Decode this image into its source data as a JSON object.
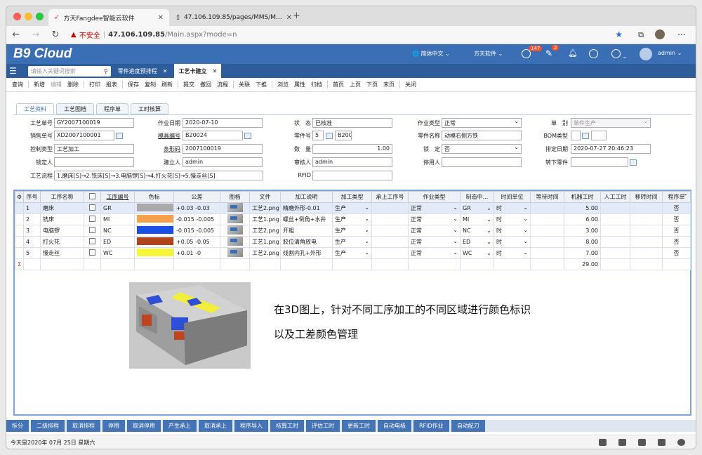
{
  "browser": {
    "tabs": [
      {
        "title": "方天Fangdee智能云软件"
      },
      {
        "title": "47.106.109.85/pages/MMS/M..."
      }
    ],
    "not_secure": "不安全",
    "url_host": "47.106.109.85",
    "url_path": "/Main.aspx?mode=n"
  },
  "app": {
    "logo": "B9 Cloud",
    "language": "简体中文",
    "company": "方天软件",
    "msg_count": "147",
    "edit_count": "2",
    "user": "admin"
  },
  "nav": {
    "search_placeholder": "请输入关键词搜索",
    "tabs": [
      {
        "label": "零件进度预排程"
      },
      {
        "label": "工艺卡建立"
      }
    ]
  },
  "toolbar": [
    "查询",
    "新增",
    "编辑",
    "删除",
    "打印",
    "报表",
    "保存",
    "复制",
    "刷新",
    "提交",
    "撤回",
    "流程",
    "关联",
    "下推",
    "浏览",
    "属性",
    "归档",
    "首页",
    "上页",
    "下页",
    "末页",
    "关闭"
  ],
  "form_tabs": [
    "工艺资料",
    "工艺图档",
    "程序单",
    "工时核算"
  ],
  "form": {
    "gy_no_label": "工艺单号",
    "gy_no": "GY2007100019",
    "xs_no_label": "销售单号",
    "xs_no": "XD2007100001",
    "ctrl_type_label": "控制类型",
    "ctrl_type": "工艺加工",
    "locker_label": "锁定人",
    "flow_label": "工艺流程",
    "flow": "1.磨床[S]→2.铣床[S]→3.电脑锣[S]→4.打火花[S]→5.慢走丝[S]",
    "work_date_label": "作业日期",
    "work_date": "2020-07-10",
    "mold_no_label": "模具编号",
    "mold_no": "B20024",
    "barcode_label": "条形码",
    "barcode": "2007100019",
    "creator_label": "建立人",
    "creator": "admin",
    "status_label": "状　态",
    "status": "已核准",
    "part_no_label": "零件号",
    "part_no_a": "5",
    "part_no_b": "B200",
    "qty_label": "数　量",
    "qty": "1.00",
    "auditor_label": "审核人",
    "auditor": "admin",
    "rfid_label": "RFID",
    "work_type_label": "作业类型",
    "work_type": "正常",
    "part_name_label": "零件名称",
    "part_name": "动模右侧方铁",
    "lock_label": "锁　定",
    "lock": "否",
    "stopper_label": "停用人",
    "unit_label": "单　别",
    "unit": "单件生产",
    "bom_label": "BOM类型",
    "sched_label": "排定日期",
    "sched": "2020-07-27 20:46:23",
    "sub_label": "转下零件"
  },
  "grid": {
    "headers": [
      "序号",
      "工序名称",
      "",
      "工序编号",
      "色标",
      "公差",
      "图档",
      "文件",
      "加工说明",
      "加工类型",
      "承上工序号",
      "作业类型",
      "制造中...",
      "时间单位",
      "等待时间",
      "机器工时",
      "人工工时",
      "移转时间",
      "程序单"
    ],
    "rows": [
      {
        "no": "1",
        "name": "磨床",
        "code": "GR",
        "color": "#a9a9a9",
        "tol": "+0.03 -0.03",
        "file": "工艺2.png",
        "desc": "精磨外形-0.01",
        "ptype": "生产",
        "wtype": "正常",
        "mfg": "GR",
        "tunit": "时",
        "mh": "5.00",
        "prog": "否"
      },
      {
        "no": "2",
        "name": "铣床",
        "code": "MI",
        "color": "#f5a04a",
        "tol": "-0.015 -0.005",
        "file": "工艺1.png",
        "desc": "螺丝+倒角+水井",
        "ptype": "生产",
        "wtype": "正常",
        "mfg": "MI",
        "tunit": "时",
        "mh": "6.00",
        "prog": "否"
      },
      {
        "no": "3",
        "name": "电脑锣",
        "code": "NC",
        "color": "#1a4fe6",
        "tol": "-0.015 -0.005",
        "file": "工艺2.png",
        "desc": "开粗",
        "ptype": "生产",
        "wtype": "正常",
        "mfg": "NC",
        "tunit": "时",
        "mh": "3.00",
        "prog": "否"
      },
      {
        "no": "4",
        "name": "打火花",
        "code": "ED",
        "color": "#b0431a",
        "tol": "+0.05 -0.05",
        "file": "工艺1.png",
        "desc": "胶位清角放电",
        "ptype": "生产",
        "wtype": "正常",
        "mfg": "ED",
        "tunit": "时",
        "mh": "8.00",
        "prog": "否"
      },
      {
        "no": "5",
        "name": "慢走丝",
        "code": "WC",
        "color": "#f5f53a",
        "tol": "+0.01 -0",
        "file": "工艺2.png",
        "desc": "线割内孔+外形",
        "ptype": "生产",
        "wtype": "正常",
        "mfg": "WC",
        "tunit": "时",
        "mh": "7.00",
        "prog": "否"
      }
    ],
    "sum_mark": "Σ",
    "sum_mh": "29.00"
  },
  "annotation": [
    "在3D图上，针对不同工序加工的不同区域进行颜色标识",
    "以及工差颜色管理"
  ],
  "bottom_buttons": [
    "拆分",
    "二级排程",
    "取消排程",
    "停用",
    "取消停用",
    "产生承上",
    "取消承上",
    "程序导入",
    "核算工时",
    "评估工时",
    "更新工时",
    "自动电极",
    "RFID作业",
    "自动配刀"
  ],
  "status_text": "今天是2020年 07月 25日 星期六"
}
